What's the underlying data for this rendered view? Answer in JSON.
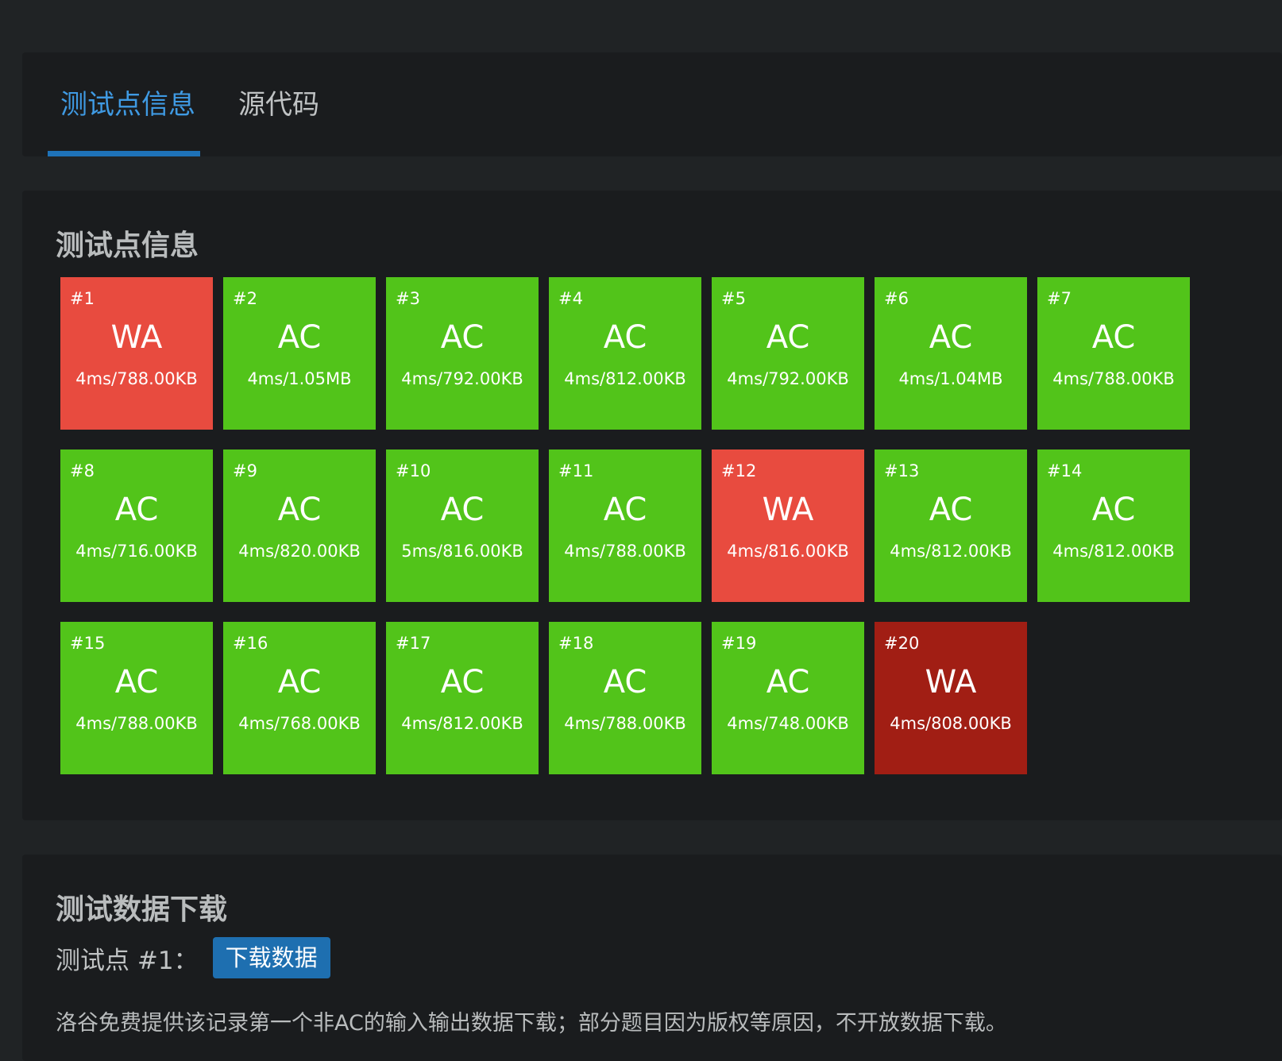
{
  "tabs": {
    "testcases_label": "测试点信息",
    "source_label": "源代码",
    "active": "testcases"
  },
  "testcases_section": {
    "title": "测试点信息",
    "items": [
      {
        "id": "#1",
        "status": "WA",
        "info": "4ms/788.00KB",
        "color": "#e84b3f"
      },
      {
        "id": "#2",
        "status": "AC",
        "info": "4ms/1.05MB",
        "color": "#52c41a"
      },
      {
        "id": "#3",
        "status": "AC",
        "info": "4ms/792.00KB",
        "color": "#52c41a"
      },
      {
        "id": "#4",
        "status": "AC",
        "info": "4ms/812.00KB",
        "color": "#52c41a"
      },
      {
        "id": "#5",
        "status": "AC",
        "info": "4ms/792.00KB",
        "color": "#52c41a"
      },
      {
        "id": "#6",
        "status": "AC",
        "info": "4ms/1.04MB",
        "color": "#52c41a"
      },
      {
        "id": "#7",
        "status": "AC",
        "info": "4ms/788.00KB",
        "color": "#52c41a"
      },
      {
        "id": "#8",
        "status": "AC",
        "info": "4ms/716.00KB",
        "color": "#52c41a"
      },
      {
        "id": "#9",
        "status": "AC",
        "info": "4ms/820.00KB",
        "color": "#52c41a"
      },
      {
        "id": "#10",
        "status": "AC",
        "info": "5ms/816.00KB",
        "color": "#52c41a"
      },
      {
        "id": "#11",
        "status": "AC",
        "info": "4ms/788.00KB",
        "color": "#52c41a"
      },
      {
        "id": "#12",
        "status": "WA",
        "info": "4ms/816.00KB",
        "color": "#e84b3f"
      },
      {
        "id": "#13",
        "status": "AC",
        "info": "4ms/812.00KB",
        "color": "#52c41a"
      },
      {
        "id": "#14",
        "status": "AC",
        "info": "4ms/812.00KB",
        "color": "#52c41a"
      },
      {
        "id": "#15",
        "status": "AC",
        "info": "4ms/788.00KB",
        "color": "#52c41a"
      },
      {
        "id": "#16",
        "status": "AC",
        "info": "4ms/768.00KB",
        "color": "#52c41a"
      },
      {
        "id": "#17",
        "status": "AC",
        "info": "4ms/812.00KB",
        "color": "#52c41a"
      },
      {
        "id": "#18",
        "status": "AC",
        "info": "4ms/788.00KB",
        "color": "#52c41a"
      },
      {
        "id": "#19",
        "status": "AC",
        "info": "4ms/748.00KB",
        "color": "#52c41a"
      },
      {
        "id": "#20",
        "status": "WA",
        "info": "4ms/808.00KB",
        "color": "#a11e14"
      }
    ]
  },
  "download_section": {
    "title": "测试数据下载",
    "label": "测试点 #1：",
    "button_label": "下载数据",
    "note": "洛谷免费提供该记录第一个非AC的输入输出数据下载；部分题目因为版权等原因，不开放数据下载。"
  },
  "colors": {
    "accepted": "#52c41a",
    "wrong_answer": "#e84b3f",
    "wrong_answer_dark": "#a11e14",
    "tab_active": "#3f9ae3",
    "button": "#1e6fb0"
  }
}
